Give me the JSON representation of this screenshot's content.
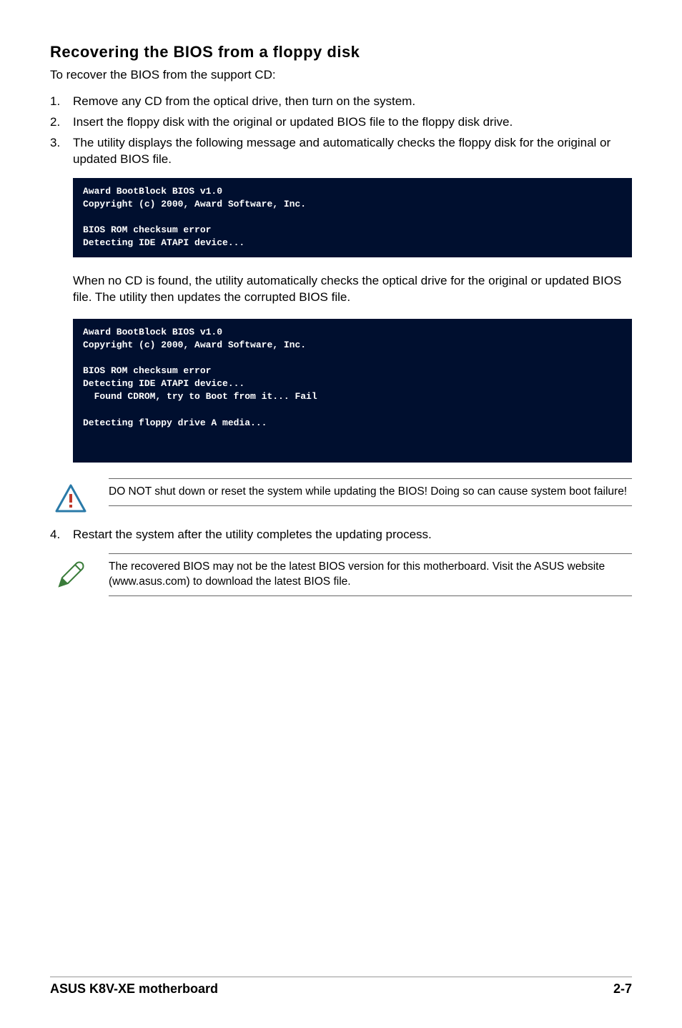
{
  "title": "Recovering the BIOS from a floppy disk",
  "intro": "To recover the BIOS from the support CD:",
  "steps": [
    {
      "n": "1.",
      "t": "Remove any CD from the optical drive, then turn on the system."
    },
    {
      "n": "2.",
      "t": "Insert the floppy disk with the original or updated BIOS file to the floppy disk drive."
    },
    {
      "n": "3.",
      "t": "The utility displays the following message and automatically checks the floppy disk for the original or updated BIOS file."
    }
  ],
  "terminal1": "Award BootBlock BIOS v1.0\nCopyright (c) 2000, Award Software, Inc.\n\nBIOS ROM checksum error\nDetecting IDE ATAPI device...\n",
  "mid_text": "When no CD is found, the utility automatically checks the optical drive for the original or updated BIOS file. The utility then updates the corrupted BIOS file.",
  "terminal2": "Award BootBlock BIOS v1.0\nCopyright (c) 2000, Award Software, Inc.\n\nBIOS ROM checksum error\nDetecting IDE ATAPI device...\n  Found CDROM, try to Boot from it... Fail\n\nDetecting floppy drive A media...\n\n\n",
  "warning_text": "DO NOT shut down or reset the system while updating the BIOS! Doing so can cause system boot failure!",
  "step4": {
    "n": "4.",
    "t": "Restart the system after the utility completes the updating process."
  },
  "note_text": "The recovered BIOS may not be the latest BIOS version for this motherboard. Visit the ASUS website (www.asus.com) to download the latest BIOS file.",
  "footer_left": "ASUS K8V-XE motherboard",
  "footer_right": "2-7"
}
